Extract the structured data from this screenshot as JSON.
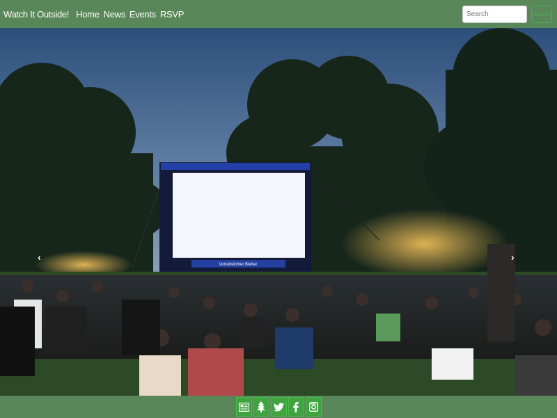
{
  "navbar": {
    "brand": "Watch It Outside!",
    "links": [
      "Home",
      "News",
      "Events",
      "RSVP"
    ],
    "search_placeholder": "Search",
    "search_button": "Search"
  },
  "hero": {
    "screen_banner": "Vorteilslichter Bieber",
    "prev_icon": "chevron-left-icon",
    "next_icon": "chevron-right-icon"
  },
  "footer": {
    "icons": [
      "newspaper-icon",
      "tree-icon",
      "twitter-icon",
      "facebook-icon",
      "instagram-icon"
    ]
  },
  "colors": {
    "nav_bg": "#5a875a",
    "social_bg": "#3fa43f",
    "search_button_border": "#4cae4c"
  }
}
